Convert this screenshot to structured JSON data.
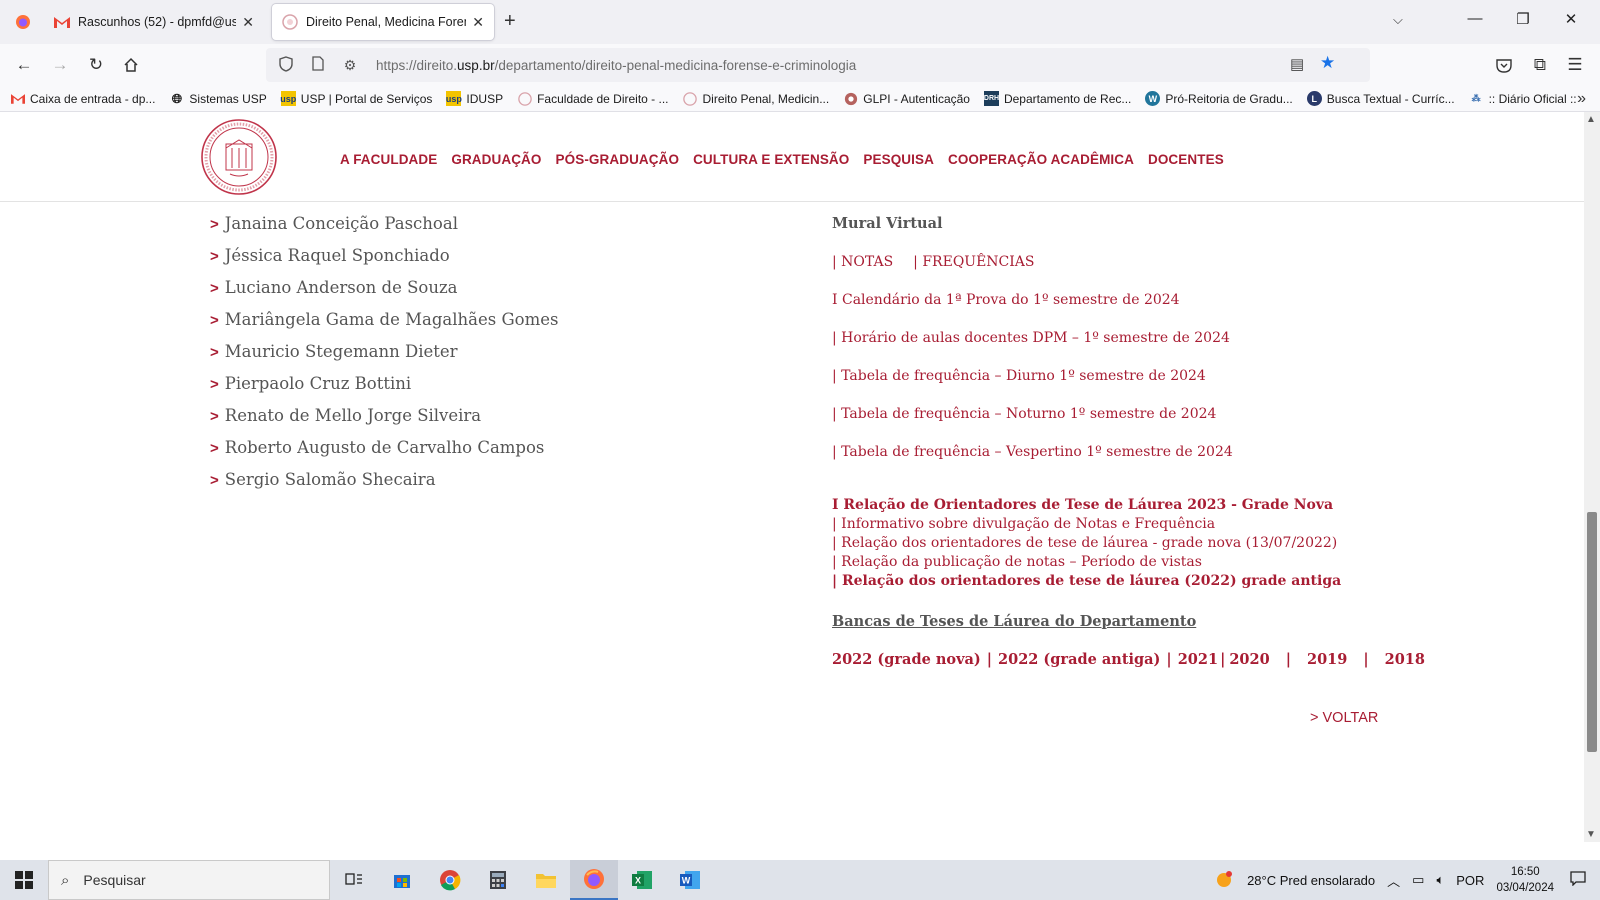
{
  "browser": {
    "tabs": [
      {
        "title": "Rascunhos (52) - dpmfd@usp.b"
      },
      {
        "title": "Direito Penal, Medicina Forense"
      }
    ],
    "url_prefix": "https://direito.",
    "url_domain": "usp.br",
    "url_path": "/departamento/direito-penal-medicina-forense-e-criminologia",
    "bookmarks": [
      {
        "label": "Caixa de entrada - dp...",
        "icon": "gmail-icon"
      },
      {
        "label": "Sistemas USP",
        "icon": "globe-icon"
      },
      {
        "label": "USP | Portal de Serviços",
        "icon": "usp-icon"
      },
      {
        "label": "IDUSP",
        "icon": "usp-icon"
      },
      {
        "label": "Faculdade de Direito - ...",
        "icon": "fd-icon"
      },
      {
        "label": "Direito Penal, Medicin...",
        "icon": "fd-icon"
      },
      {
        "label": "GLPI - Autenticação",
        "icon": "glpi-icon"
      },
      {
        "label": "Departamento de Rec...",
        "icon": "drh-icon"
      },
      {
        "label": "Pró-Reitoria de Gradu...",
        "icon": "wordpress-icon"
      },
      {
        "label": "Busca Textual - Curríc...",
        "icon": "lattes-icon"
      },
      {
        "label": ":: Diário Oficial ::",
        "icon": "diario-icon"
      }
    ]
  },
  "site": {
    "nav": [
      "A FACULDADE",
      "GRADUAÇÃO",
      "PÓS-GRADUAÇÃO",
      "CULTURA E EXTENSÃO",
      "PESQUISA",
      "COOPERAÇÃO ACADÊMICA",
      "DOCENTES"
    ],
    "docentes": [
      "Janaina Conceição Paschoal",
      "Jéssica Raquel Sponchiado",
      "Luciano Anderson de Souza",
      "Mariângela Gama de Magalhães Gomes",
      "Mauricio Stegemann Dieter",
      "Pierpaolo Cruz Bottini",
      "Renato de Mello Jorge Silveira",
      "Roberto Augusto de Carvalho Campos",
      "Sergio Salomão Shecaira"
    ],
    "docentes_marker": ">",
    "mural": {
      "title": "Mural Virtual",
      "notas": "| NOTAS",
      "frequencias": "| FREQUÊNCIAS",
      "calendario": "I Calendário da 1ª Prova do 1º semestre de 2024",
      "horario": "| Horário de aulas docentes DPM – 1º semestre de 2024",
      "freq_diurno": "| Tabela de frequência – Diurno 1º semestre de 2024",
      "freq_noturno": "| Tabela de frequência – Noturno 1º semestre de 2024",
      "freq_vespertino": "| Tabela de frequência – Vespertino 1º semestre de 2024",
      "orientadores_2023": "I Relação de Orientadores de Tese de Láurea 2023 - Grade Nova",
      "informativo": "| Informativo sobre divulgação de Notas e Frequência",
      "orientadores_2022_nova": "| Relação dos orientadores de tese de láurea - grade nova (13/07/2022)",
      "publicacao_notas": "| Relação da publicação de notas – Período de vistas",
      "orientadores_2022_antiga": "| Relação dos orientadores de tese de láurea (2022) grade antiga",
      "bancas_title": "Bancas de Teses de Láurea do Departamento",
      "years": [
        "2022 (grade nova)",
        "2022 (grade antiga)",
        "2021",
        "2020",
        "2019",
        "2018"
      ],
      "year_sep": "|"
    },
    "voltar": "> VOLTAR"
  },
  "taskbar": {
    "search_placeholder": "Pesquisar",
    "weather": "28°C  Pred ensolarado",
    "lang": "POR",
    "time": "16:50",
    "date": "03/04/2024"
  },
  "colors": {
    "brand": "#a81d33",
    "text_gray": "#555555"
  }
}
